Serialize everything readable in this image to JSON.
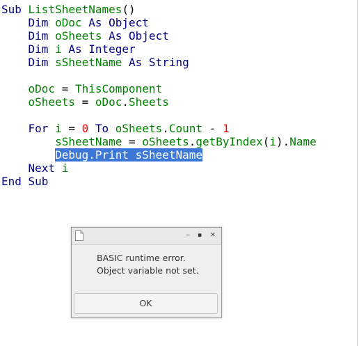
{
  "code": {
    "lines": [
      [
        {
          "t": "Sub ",
          "c": "kw"
        },
        {
          "t": "ListSheetNames",
          "c": "id"
        },
        {
          "t": "()",
          "c": "op"
        }
      ],
      [
        {
          "t": "    Dim ",
          "c": "kw"
        },
        {
          "t": "oDoc",
          "c": "id"
        },
        {
          "t": " As ",
          "c": "kw"
        },
        {
          "t": "Object",
          "c": "kw"
        }
      ],
      [
        {
          "t": "    Dim ",
          "c": "kw"
        },
        {
          "t": "oSheets",
          "c": "id"
        },
        {
          "t": " As ",
          "c": "kw"
        },
        {
          "t": "Object",
          "c": "kw"
        }
      ],
      [
        {
          "t": "    Dim ",
          "c": "kw"
        },
        {
          "t": "i",
          "c": "id"
        },
        {
          "t": " As ",
          "c": "kw"
        },
        {
          "t": "Integer",
          "c": "kw"
        }
      ],
      [
        {
          "t": "    Dim ",
          "c": "kw"
        },
        {
          "t": "sSheetName",
          "c": "id"
        },
        {
          "t": " As ",
          "c": "kw"
        },
        {
          "t": "String",
          "c": "kw"
        }
      ],
      [],
      [
        {
          "t": "    ",
          "c": "op"
        },
        {
          "t": "oDoc",
          "c": "id"
        },
        {
          "t": " = ",
          "c": "op"
        },
        {
          "t": "ThisComponent",
          "c": "id"
        }
      ],
      [
        {
          "t": "    ",
          "c": "op"
        },
        {
          "t": "oSheets",
          "c": "id"
        },
        {
          "t": " = ",
          "c": "op"
        },
        {
          "t": "oDoc",
          "c": "id"
        },
        {
          "t": ".",
          "c": "op"
        },
        {
          "t": "Sheets",
          "c": "id"
        }
      ],
      [],
      [
        {
          "t": "    For ",
          "c": "kw"
        },
        {
          "t": "i",
          "c": "id"
        },
        {
          "t": " = ",
          "c": "op"
        },
        {
          "t": "0",
          "c": "num"
        },
        {
          "t": " To ",
          "c": "kw"
        },
        {
          "t": "oSheets",
          "c": "id"
        },
        {
          "t": ".",
          "c": "op"
        },
        {
          "t": "Count",
          "c": "id"
        },
        {
          "t": " - ",
          "c": "op"
        },
        {
          "t": "1",
          "c": "num"
        }
      ],
      [
        {
          "t": "        ",
          "c": "op"
        },
        {
          "t": "sSheetName",
          "c": "id"
        },
        {
          "t": " = ",
          "c": "op"
        },
        {
          "t": "oSheets",
          "c": "id"
        },
        {
          "t": ".",
          "c": "op"
        },
        {
          "t": "getByIndex",
          "c": "id"
        },
        {
          "t": "(",
          "c": "op"
        },
        {
          "t": "i",
          "c": "id"
        },
        {
          "t": ").",
          "c": "op"
        },
        {
          "t": "Name",
          "c": "id"
        }
      ],
      [
        {
          "t": "        ",
          "c": "op"
        },
        {
          "t": "Debug.Print sSheetName",
          "c": "sel"
        }
      ],
      [
        {
          "t": "    Next ",
          "c": "kw"
        },
        {
          "t": "i",
          "c": "id"
        }
      ],
      [
        {
          "t": "End Sub",
          "c": "kw"
        }
      ]
    ]
  },
  "dialog": {
    "message_line1": "BASIC runtime error.",
    "message_line2": "Object variable not set.",
    "ok_label": "OK",
    "buttons": {
      "minimize": "‒",
      "maximize": "▪",
      "close": "✕"
    }
  },
  "colors": {
    "keyword": "#000080",
    "identifier": "#008000",
    "number": "#ff0000",
    "selection": "#3d78d6"
  }
}
